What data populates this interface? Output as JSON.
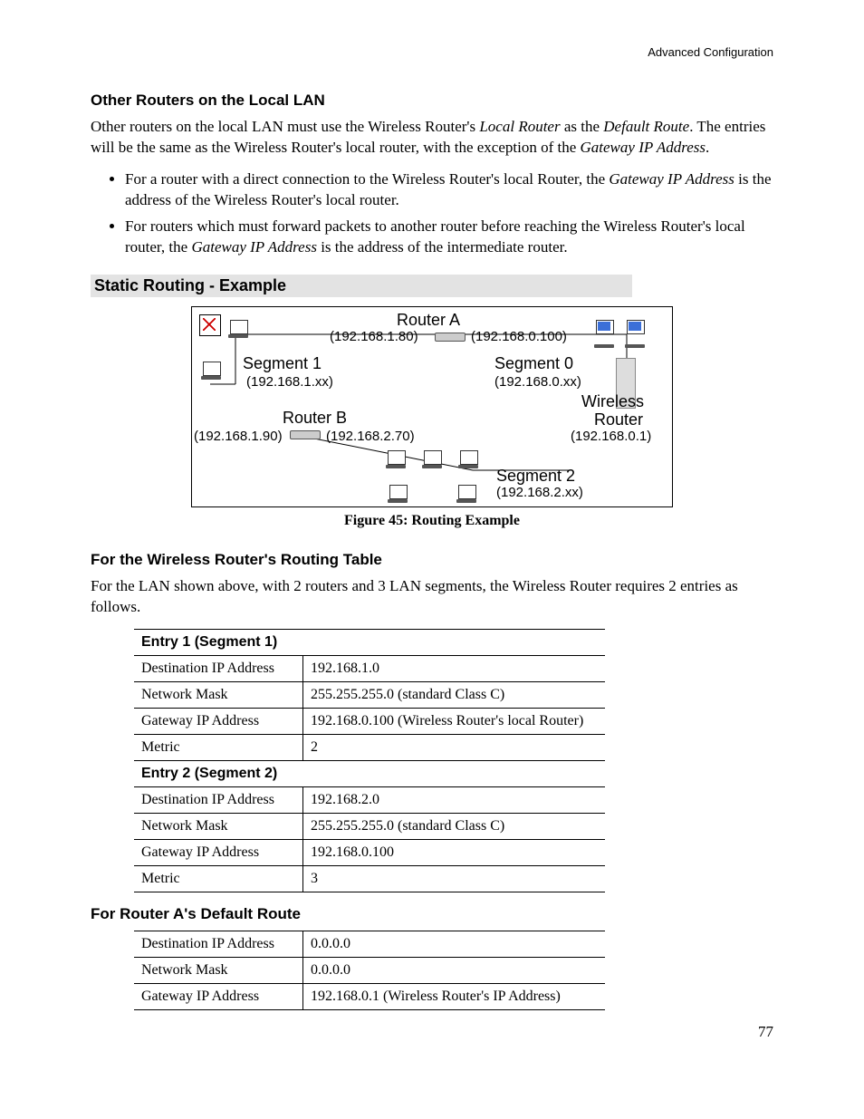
{
  "header": {
    "text": "Advanced Configuration"
  },
  "page_number": "77",
  "s1": {
    "heading": "Other Routers on the Local LAN",
    "para_a": "Other routers on the local LAN must use the Wireless Router's ",
    "para_b": "Local Router",
    "para_c": " as the ",
    "para_d": "Default Route",
    "para_e": ". The entries will be the same as the Wireless Router's local router, with the exception of the ",
    "para_f": "Gateway IP Address",
    "para_g": ".",
    "b1a": "For a router with a direct connection to the Wireless Router's local Router, the ",
    "b1b": "Gateway IP Address",
    "b1c": " is the address of the Wireless Router's local router.",
    "b2a": "For routers which must forward packets to another router before reaching the Wireless Router's local router, the ",
    "b2b": "Gateway IP Address",
    "b2c": " is the address of the intermediate router."
  },
  "s2": {
    "heading": "Static Routing - Example",
    "caption": "Figure 45: Routing Example",
    "diagram": {
      "routerA": "Router A",
      "routerA_left": "(192.168.1.80)",
      "routerA_right": "(192.168.0.100)",
      "seg1": "Segment 1",
      "seg1_sub": "(192.168.1.xx)",
      "seg0": "Segment 0",
      "seg0_sub": "(192.168.0.xx)",
      "routerB": "Router B",
      "routerB_left": "(192.168.1.90)",
      "routerB_right": "(192.168.2.70)",
      "wireless": "Wireless",
      "router_w": "Router",
      "wireless_sub": "(192.168.0.1)",
      "seg2": "Segment 2",
      "seg2_sub": "(192.168.2.xx)"
    }
  },
  "s3": {
    "heading": "For the Wireless Router's Routing Table",
    "para": "For the LAN shown above, with 2 routers and 3 LAN segments, the Wireless Router requires 2 entries as follows.",
    "entry1": {
      "title": "Entry 1 (Segment 1)",
      "r1k": "Destination IP Address",
      "r1v": "192.168.1.0",
      "r2k": "Network Mask",
      "r2v": "255.255.255.0  (standard Class C)",
      "r3k": "Gateway IP Address",
      "r3v": "192.168.0.100  (Wireless Router's local Router)",
      "r4k": "Metric",
      "r4v": "2"
    },
    "entry2": {
      "title": "Entry 2 (Segment 2)",
      "r1k": "Destination IP Address",
      "r1v": "192.168.2.0",
      "r2k": "Network Mask",
      "r2v": "255.255.255.0  (standard Class C)",
      "r3k": "Gateway IP Address",
      "r3v": "192.168.0.100",
      "r4k": "Metric",
      "r4v": "3"
    }
  },
  "s4": {
    "heading": "For Router A's Default Route",
    "r1k": "Destination IP Address",
    "r1v": "0.0.0.0",
    "r2k": "Network Mask",
    "r2v": "0.0.0.0",
    "r3k": "Gateway IP Address",
    "r3v": "192.168.0.1  (Wireless Router's IP Address)"
  }
}
